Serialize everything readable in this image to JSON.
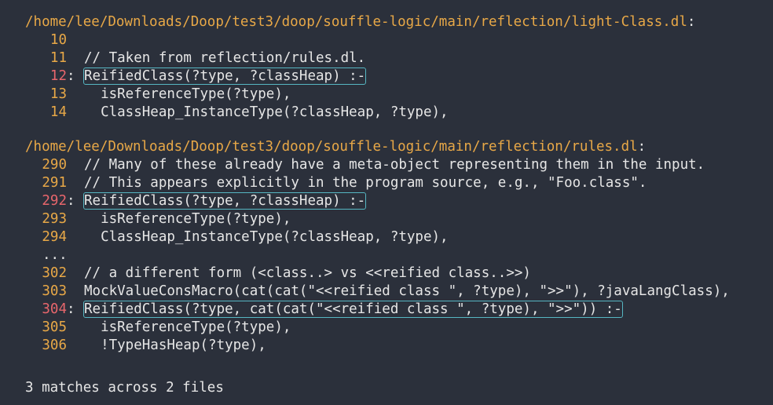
{
  "files": [
    {
      "path": "/home/lee/Downloads/Doop/test3/doop/souffle-logic/main/reflection/light-Class.dl",
      "lines": [
        {
          "num": "10",
          "sep": "",
          "code": "",
          "match": false
        },
        {
          "num": "11",
          "sep": "",
          "code": "// Taken from reflection/rules.dl.",
          "match": false
        },
        {
          "num": "12",
          "sep": ":",
          "code": "ReifiedClass(?type, ?classHeap) :-",
          "match": true
        },
        {
          "num": "13",
          "sep": "",
          "code": "  isReferenceType(?type),",
          "match": false
        },
        {
          "num": "14",
          "sep": "",
          "code": "  ClassHeap_InstanceType(?classHeap, ?type),",
          "match": false
        }
      ]
    },
    {
      "path": "/home/lee/Downloads/Doop/test3/doop/souffle-logic/main/reflection/rules.dl",
      "lines": [
        {
          "num": "290",
          "sep": "",
          "code": "// Many of these already have a meta-object representing them in the input.",
          "match": false
        },
        {
          "num": "291",
          "sep": "",
          "code": "// This appears explicitly in the program source, e.g., \"Foo.class\".",
          "match": false
        },
        {
          "num": "292",
          "sep": ":",
          "code": "ReifiedClass(?type, ?classHeap) :-",
          "match": true
        },
        {
          "num": "293",
          "sep": "",
          "code": "  isReferenceType(?type),",
          "match": false
        },
        {
          "num": "294",
          "sep": "",
          "code": "  ClassHeap_InstanceType(?classHeap, ?type),",
          "match": false
        },
        {
          "num": "...",
          "sep": "",
          "code": "",
          "match": false,
          "ellipsis": true
        },
        {
          "num": "302",
          "sep": "",
          "code": "// a different form (<class..> vs <<reified class..>>)",
          "match": false
        },
        {
          "num": "303",
          "sep": "",
          "code": "MockValueConsMacro(cat(cat(\"<<reified class \", ?type), \">>\"), ?javaLangClass),",
          "match": false
        },
        {
          "num": "304",
          "sep": ":",
          "code": "ReifiedClass(?type, cat(cat(\"<<reified class \", ?type), \">>\")) :-",
          "match": true
        },
        {
          "num": "305",
          "sep": "",
          "code": "  isReferenceType(?type),",
          "match": false
        },
        {
          "num": "306",
          "sep": "",
          "code": "  !TypeHasHeap(?type),",
          "match": false
        }
      ]
    }
  ],
  "summary": "3 matches across 2 files",
  "colors": {
    "background": "#2b303b",
    "path": "#e8a847",
    "line_number": "#e8a847",
    "match_line_number": "#e8666c",
    "highlight_border": "#56b6c2",
    "text": "#e6e6e6"
  }
}
